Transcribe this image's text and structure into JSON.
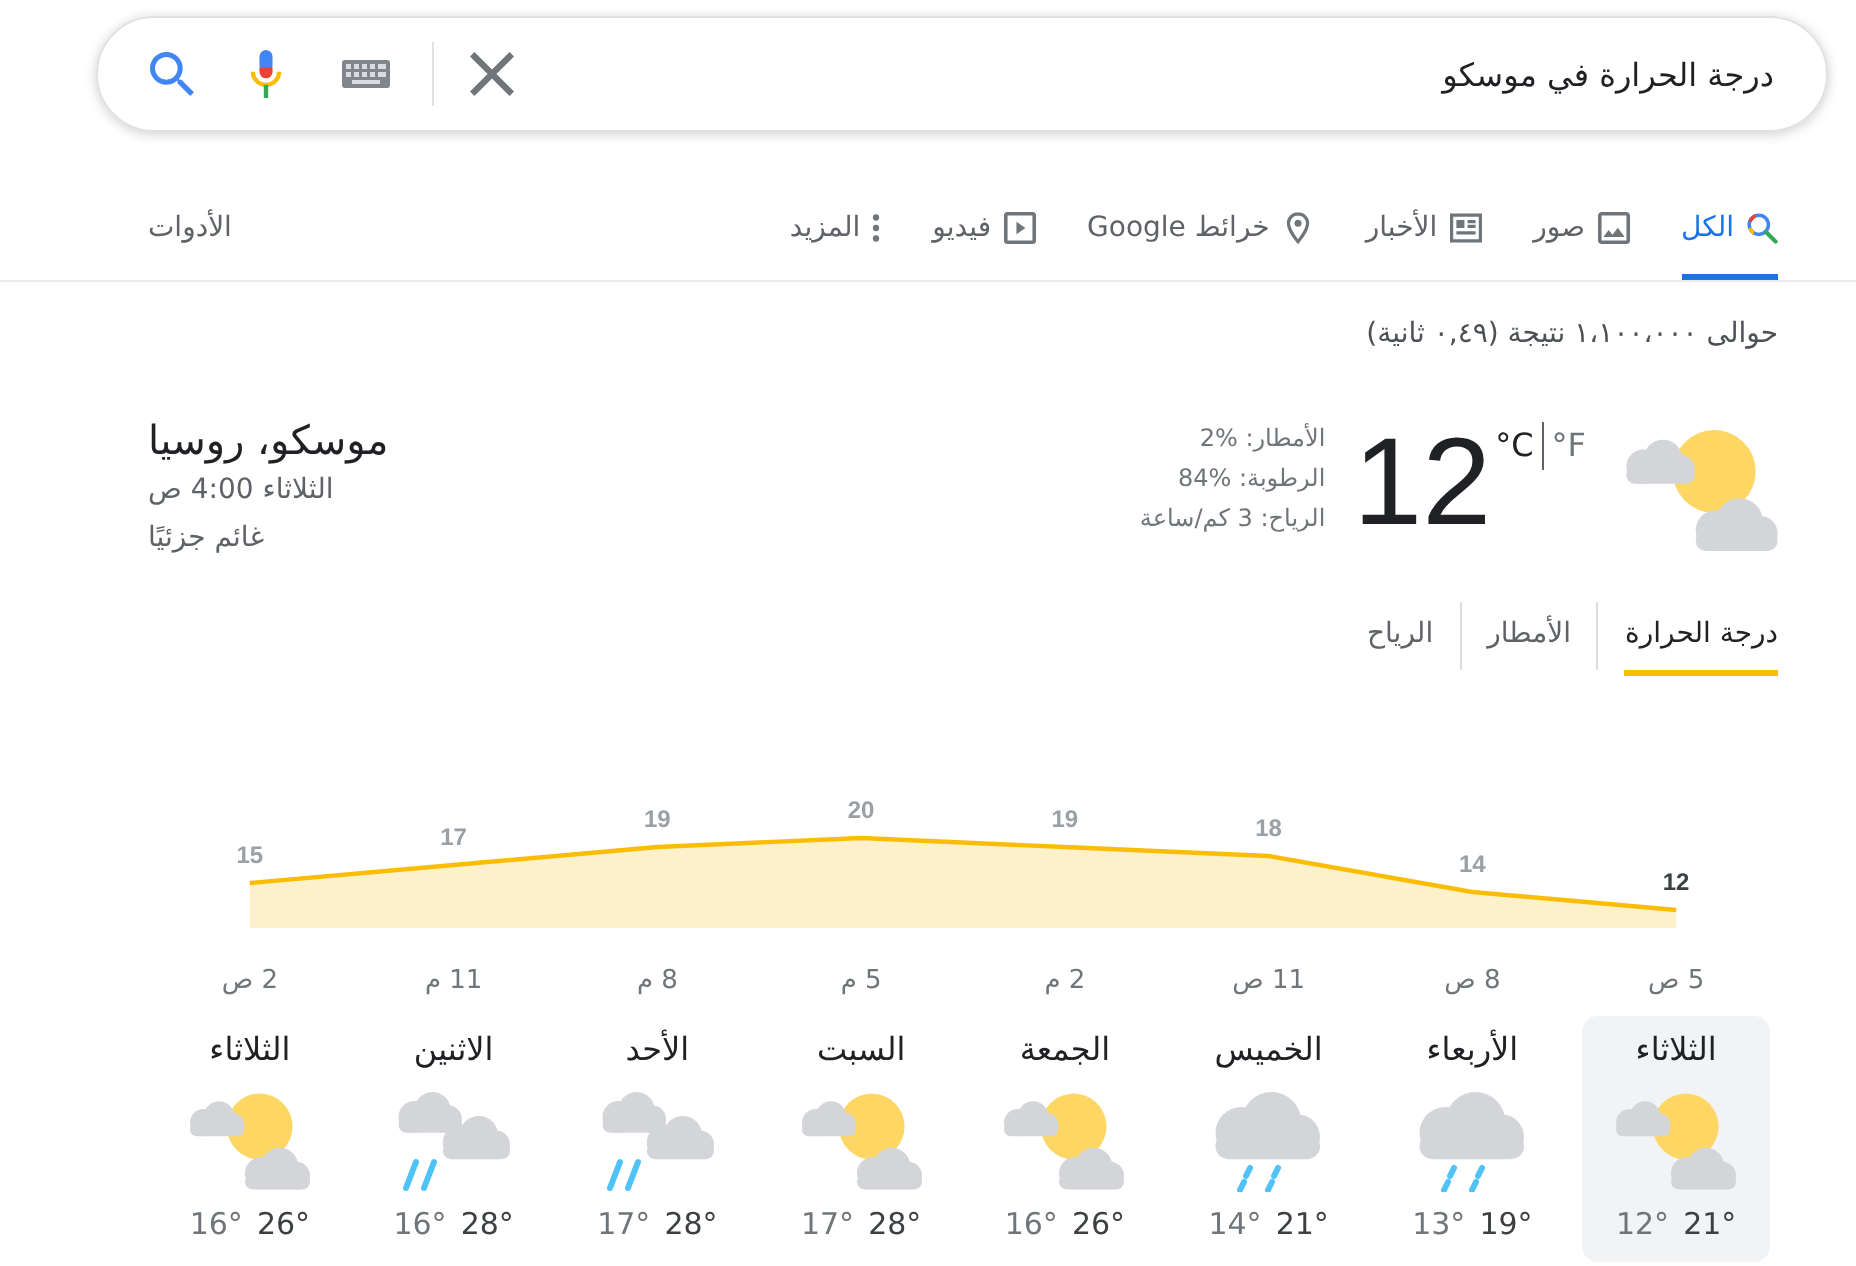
{
  "search": {
    "query": "درجة الحرارة في موسكو"
  },
  "tabs": [
    {
      "label": "الكل",
      "kind": "all",
      "selected": true
    },
    {
      "label": "صور",
      "kind": "images",
      "selected": false
    },
    {
      "label": "الأخبار",
      "kind": "news",
      "selected": false
    },
    {
      "label": "خرائط Google",
      "kind": "maps",
      "selected": false
    },
    {
      "label": "فيديو",
      "kind": "videos",
      "selected": false
    },
    {
      "label": "المزيد",
      "kind": "more",
      "selected": false
    }
  ],
  "tools": "الأدوات",
  "result_stats": "حوالى ١،١٠٠،٠٠٠ نتيجة (٠,٤٩ ثانية)",
  "weather": {
    "units": [
      {
        "label": "°F",
        "selected": false
      },
      {
        "label": "°C",
        "selected": true
      }
    ],
    "temperature": "12",
    "details": [
      {
        "label": "الأمطار:",
        "value": "2%"
      },
      {
        "label": "الرطوبة:",
        "value": "84%"
      },
      {
        "label": "الرياح:",
        "value": "3 كم/ساعة"
      }
    ],
    "location": "موسكو، روسيا",
    "time": "الثلاثاء 4:00 ص",
    "condition": "غائم جزئيًا",
    "tabs": [
      {
        "label": "درجة الحرارة",
        "selected": true
      },
      {
        "label": "الأمطار",
        "selected": false
      },
      {
        "label": "الرياح",
        "selected": false
      }
    ],
    "chart_data": {
      "type": "area",
      "categories": [
        "2 ص",
        "11 م",
        "8 م",
        "5 م",
        "2 م",
        "11 ص",
        "8 ص",
        "5 ص"
      ],
      "values": [
        15,
        17,
        19,
        20,
        19,
        18,
        14,
        12
      ],
      "data_labels": true
    },
    "days": [
      {
        "day": "الثلاثاء",
        "kind": "partly-cloudy",
        "high": "21°",
        "low": "12°",
        "selected": true
      },
      {
        "day": "الأربعاء",
        "kind": "showers",
        "high": "19°",
        "low": "13°",
        "selected": false
      },
      {
        "day": "الخميس",
        "kind": "showers",
        "high": "21°",
        "low": "14°",
        "selected": false
      },
      {
        "day": "الجمعة",
        "kind": "partly-cloudy",
        "high": "26°",
        "low": "16°",
        "selected": false
      },
      {
        "day": "السبت",
        "kind": "partly-cloudy",
        "high": "28°",
        "low": "17°",
        "selected": false
      },
      {
        "day": "الأحد",
        "kind": "rain",
        "high": "28°",
        "low": "17°",
        "selected": false
      },
      {
        "day": "الاثنين",
        "kind": "rain",
        "high": "28°",
        "low": "16°",
        "selected": false
      },
      {
        "day": "الثلاثاء",
        "kind": "partly-cloudy",
        "high": "26°",
        "low": "16°",
        "selected": false
      }
    ]
  }
}
